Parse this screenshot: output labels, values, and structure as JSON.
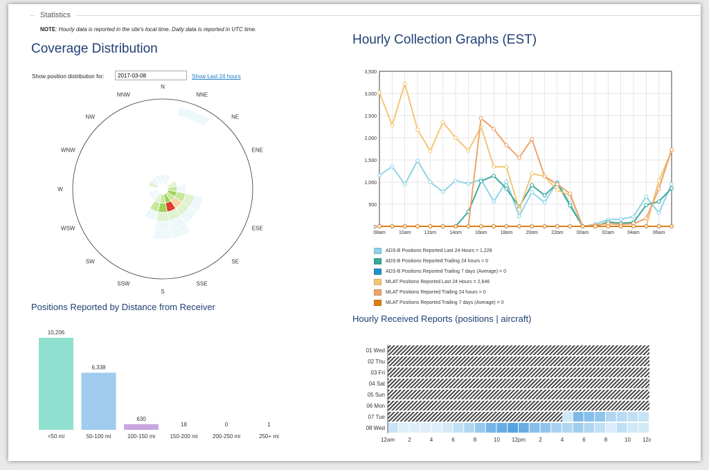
{
  "fieldset_title": "Statistics",
  "note": {
    "label": "NOTE",
    "text": ": Hourly data is reported in the site's local time. Daily data is reported in UTC time."
  },
  "coverage": {
    "title": "Coverage Distribution",
    "show_label": "Show position distribution for:",
    "date_value": "2017-03-08",
    "last24_link": "Show Last 24 hours"
  },
  "distance_title": "Positions Reported by Distance from Receiver",
  "hourly_title": "Hourly Collection Graphs (EST)",
  "received_title": "Hourly Received Reports (positions | aircraft)",
  "colors": {
    "heading": "#1f3f73",
    "adsb_last": "#8fd3e8",
    "adsb_trailing24": "#3aa89a",
    "adsb_trailing7": "#2193c9",
    "mlat_last": "#f2c774",
    "mlat_trailing24": "#eea36b",
    "mlat_trailing7": "#dd7f16"
  },
  "chart_data": [
    {
      "type": "polar",
      "title": "Coverage Distribution",
      "directions": [
        "N",
        "NNE",
        "NE",
        "ENE",
        "E",
        "ESE",
        "SE",
        "SSE",
        "S",
        "SSW",
        "SW",
        "WSW",
        "W",
        "WNW",
        "NW",
        "NNW"
      ],
      "cells": [
        {
          "sector": "NNE",
          "ring": [
            0.83,
            0.93
          ],
          "level": 0
        },
        {
          "sector": "NNE",
          "ring": [
            0.06,
            0.16
          ],
          "level": 0
        },
        {
          "sector": "ENE",
          "ring": [
            0.06,
            0.16
          ],
          "level": 1
        },
        {
          "sector": "E",
          "ring": [
            0.06,
            0.16
          ],
          "level": 2
        },
        {
          "sector": "E",
          "ring": [
            0.16,
            0.26
          ],
          "level": 0
        },
        {
          "sector": "ESE",
          "ring": [
            0.06,
            0.16
          ],
          "level": 3
        },
        {
          "sector": "ESE",
          "ring": [
            0.16,
            0.26
          ],
          "level": 2
        },
        {
          "sector": "ESE",
          "ring": [
            0.26,
            0.36
          ],
          "level": 1
        },
        {
          "sector": "ESE",
          "ring": [
            0.36,
            0.46
          ],
          "level": 0
        },
        {
          "sector": "SE",
          "ring": [
            0.06,
            0.16
          ],
          "level": 2
        },
        {
          "sector": "SE",
          "ring": [
            0.16,
            0.26
          ],
          "level": 4
        },
        {
          "sector": "SE",
          "ring": [
            0.26,
            0.36
          ],
          "level": 1
        },
        {
          "sector": "SE",
          "ring": [
            0.36,
            0.46
          ],
          "level": 0
        },
        {
          "sector": "SSE",
          "ring": [
            0.06,
            0.16
          ],
          "level": 3
        },
        {
          "sector": "SSE",
          "ring": [
            0.16,
            0.26
          ],
          "level": 5
        },
        {
          "sector": "SSE",
          "ring": [
            0.26,
            0.36
          ],
          "level": 1
        },
        {
          "sector": "SSE",
          "ring": [
            0.36,
            0.46
          ],
          "level": 0
        },
        {
          "sector": "SSE",
          "ring": [
            0.46,
            0.56
          ],
          "level": 0
        },
        {
          "sector": "S",
          "ring": [
            0.06,
            0.16
          ],
          "level": 2
        },
        {
          "sector": "S",
          "ring": [
            0.16,
            0.26
          ],
          "level": 3
        },
        {
          "sector": "S",
          "ring": [
            0.26,
            0.36
          ],
          "level": 1
        },
        {
          "sector": "S",
          "ring": [
            0.36,
            0.46
          ],
          "level": 0
        },
        {
          "sector": "S",
          "ring": [
            0.46,
            0.56
          ],
          "level": 0
        },
        {
          "sector": "SSW",
          "ring": [
            0.06,
            0.16
          ],
          "level": 1
        },
        {
          "sector": "SSW",
          "ring": [
            0.16,
            0.26
          ],
          "level": 2
        },
        {
          "sector": "SSW",
          "ring": [
            0.26,
            0.36
          ],
          "level": 0
        },
        {
          "sector": "SW",
          "ring": [
            0.06,
            0.16
          ],
          "level": 0
        },
        {
          "sector": "WSW",
          "ring": [
            0.06,
            0.16
          ],
          "level": 0
        },
        {
          "sector": "WNW",
          "ring": [
            0.06,
            0.16
          ],
          "level": 1
        },
        {
          "sector": "NW",
          "ring": [
            0.06,
            0.16
          ],
          "level": 0
        },
        {
          "sector": "NNW",
          "ring": [
            0.06,
            0.16
          ],
          "level": 0
        },
        {
          "sector": "N",
          "ring": [
            0.06,
            0.16
          ],
          "level": 0
        }
      ],
      "level_colors": [
        "#eef8fb",
        "#e0f2cf",
        "#c5e89a",
        "#9fd35a",
        "#f7d7a9",
        "#e03c2c"
      ]
    },
    {
      "type": "bar",
      "title": "Positions Reported by Distance from Receiver",
      "categories": [
        "<50 mi",
        "50-100 mi",
        "100-150 mi",
        "150-200 mi",
        "200-250 mi",
        "250+ mi"
      ],
      "values": [
        10206,
        6338,
        630,
        18,
        0,
        1
      ],
      "labels": [
        "10,206",
        "6,338",
        "630",
        "18",
        "0",
        "1"
      ],
      "colors": [
        "#8fe0cf",
        "#9fccee",
        "#c9a6df",
        "#cccccc",
        "#cccccc",
        "#cccccc"
      ],
      "ylim": [
        0,
        10206
      ]
    },
    {
      "type": "line",
      "title": "Hourly Collection Graphs (EST)",
      "x_hours": [
        8,
        9,
        10,
        11,
        12,
        13,
        14,
        15,
        16,
        17,
        18,
        19,
        20,
        21,
        22,
        23,
        0,
        1,
        2,
        3,
        4,
        5,
        6,
        7
      ],
      "x_ticks": [
        "08am",
        "10am",
        "12pm",
        "14pm",
        "16pm",
        "18pm",
        "20pm",
        "22pm",
        "00am",
        "02am",
        "04am",
        "06am"
      ],
      "ylim": [
        0,
        3500
      ],
      "y_ticks": [
        "0",
        "500",
        "1,000",
        "1,500",
        "2,000",
        "2,500",
        "3,000",
        "3,500"
      ],
      "grid": true,
      "series": [
        {
          "name": "ADS-B Positions Reported Last 24 Hours = 1,228",
          "color": "#8fd3e8",
          "values": [
            1150,
            1350,
            950,
            1480,
            1000,
            780,
            1030,
            960,
            1060,
            560,
            1010,
            230,
            770,
            540,
            1000,
            520,
            0,
            50,
            150,
            160,
            220,
            670,
            300,
            950
          ]
        },
        {
          "name": "ADS-B Positions Reported Trailing 24 hours = 0",
          "color": "#3aa89a",
          "values": [
            0,
            0,
            0,
            0,
            0,
            0,
            0,
            330,
            1020,
            1140,
            850,
            440,
            930,
            700,
            970,
            470,
            0,
            0,
            100,
            70,
            90,
            480,
            560,
            860
          ]
        },
        {
          "name": "ADS-B Positions Reported Trailing 7 days (Average) = 0",
          "color": "#2193c9",
          "values": [
            0,
            0,
            0,
            0,
            0,
            0,
            0,
            0,
            0,
            0,
            0,
            0,
            0,
            0,
            0,
            0,
            0,
            0,
            0,
            0,
            0,
            0,
            0,
            0
          ]
        },
        {
          "name": "MLAT Positions Reported Last 24 Hours = 2,646",
          "color": "#f2c774",
          "values": [
            3020,
            2280,
            3220,
            2180,
            1700,
            2350,
            2000,
            1710,
            2250,
            1350,
            1340,
            380,
            1190,
            1130,
            820,
            700,
            0,
            0,
            0,
            0,
            0,
            0,
            1030,
            1700
          ]
        },
        {
          "name": "MLAT Positions Reported Trailing 24 hours = 0",
          "color": "#eea36b",
          "values": [
            0,
            0,
            0,
            0,
            0,
            0,
            0,
            0,
            2440,
            2200,
            1830,
            1550,
            1970,
            1130,
            950,
            740,
            0,
            30,
            60,
            40,
            60,
            180,
            850,
            1730
          ]
        },
        {
          "name": "MLAT Positions Reported Trailing 7 days (Average) = 0",
          "color": "#dd7f16",
          "values": [
            0,
            0,
            0,
            0,
            0,
            0,
            0,
            0,
            0,
            0,
            0,
            0,
            0,
            0,
            0,
            0,
            0,
            0,
            0,
            0,
            0,
            0,
            0,
            0
          ]
        }
      ]
    },
    {
      "type": "heatmap",
      "title": "Hourly Received Reports (positions | aircraft)",
      "rows": [
        "01 Wed",
        "02 Thu",
        "03 Fri",
        "04 Sat",
        "05 Sun",
        "06 Mon",
        "07 Tue",
        "08 Wed"
      ],
      "x_ticks": [
        "12am",
        "2",
        "4",
        "6",
        "8",
        "10",
        "12pm",
        "2",
        "4",
        "6",
        "8",
        "10",
        "12am"
      ],
      "no_data_before": [
        24,
        24,
        24,
        24,
        24,
        24,
        16,
        0
      ],
      "values": [
        [],
        [],
        [],
        [],
        [],
        [],
        [
          null,
          null,
          null,
          null,
          null,
          null,
          null,
          null,
          null,
          null,
          null,
          null,
          null,
          null,
          null,
          null,
          0.1,
          0.6,
          0.55,
          0.5,
          0.3,
          0.25,
          0.2,
          0.15
        ],
        [
          0.15,
          0.03,
          0.03,
          0.03,
          0.03,
          0.08,
          0.2,
          0.3,
          0.45,
          0.65,
          0.75,
          0.85,
          0.75,
          0.55,
          0.5,
          0.35,
          0.3,
          0.4,
          0.3,
          0.2,
          0.05,
          0.2,
          0.1,
          0.1
        ]
      ]
    }
  ]
}
